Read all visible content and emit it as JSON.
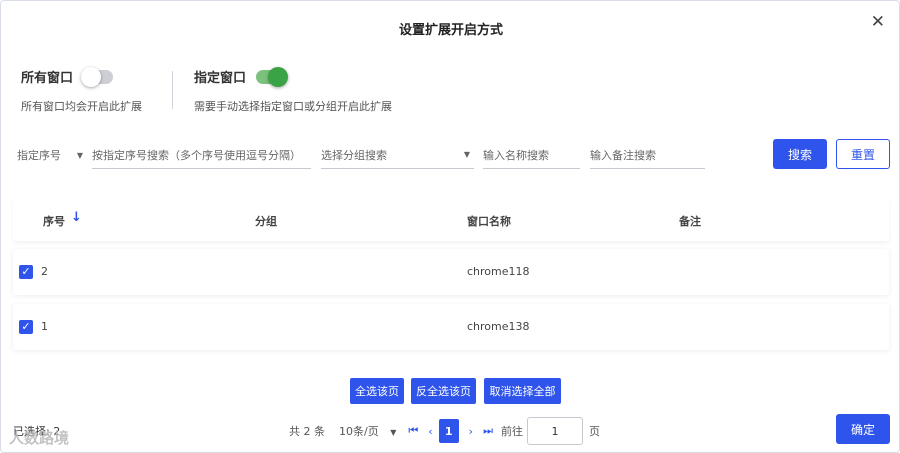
{
  "dialog": {
    "title": "设置扩展开启方式"
  },
  "modes": {
    "all_label": "所有窗口",
    "all_desc": "所有窗口均会开启此扩展",
    "specific_label": "指定窗口",
    "specific_desc": "需要手动选择指定窗口或分组开启此扩展"
  },
  "filters": {
    "serial_select": "指定序号",
    "serial_search_placeholder": "按指定序号搜索（多个序号使用逗号分隔）",
    "group_select_placeholder": "选择分组搜索",
    "name_placeholder": "输入名称搜索",
    "remark_placeholder": "输入备注搜索",
    "search_label": "搜索",
    "reset_label": "重置"
  },
  "table": {
    "headers": {
      "serial": "序号",
      "group": "分组",
      "window_name": "窗口名称",
      "remark": "备注"
    },
    "rows": [
      {
        "serial": "2",
        "group": "",
        "window_name": "chrome118",
        "remark": ""
      },
      {
        "serial": "1",
        "group": "",
        "window_name": "chrome138",
        "remark": ""
      }
    ]
  },
  "actions": {
    "select_page": "全选该页",
    "invert_page": "反全选该页",
    "cancel_all": "取消选择全部"
  },
  "pagination": {
    "total": "共 2 条",
    "page_size": "10条/页",
    "current_page": "1",
    "goto_label": "前往",
    "goto_value": "1",
    "page_unit": "页"
  },
  "footer": {
    "selected": "已选择: 2",
    "confirm_label": "确定",
    "watermark": "人数路境"
  },
  "colors": {
    "primary": "#2f54eb",
    "toggle_on": "#3aa345",
    "toggle_off": "#cdcfd4"
  }
}
